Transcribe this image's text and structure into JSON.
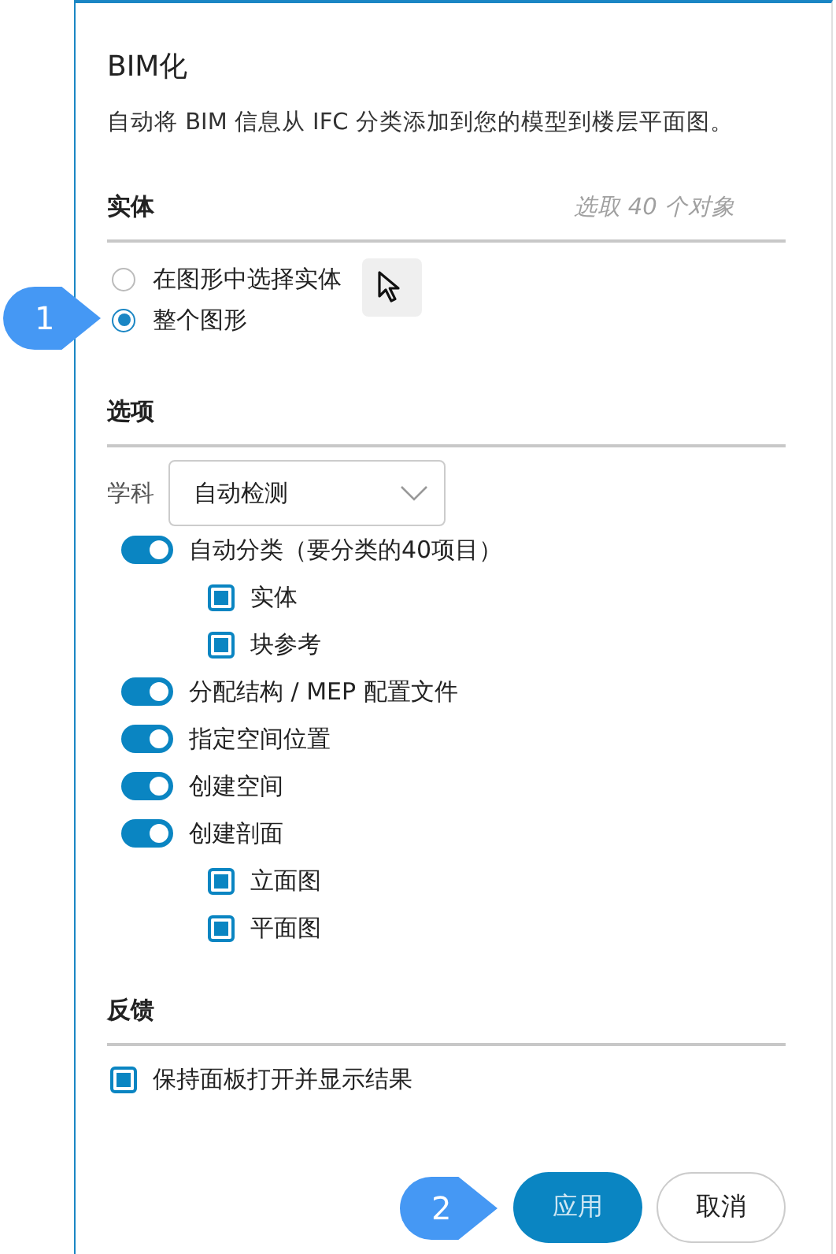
{
  "panel": {
    "title": "BIM化",
    "description": "自动将 BIM 信息从 IFC 分类添加到您的模型到楼层平面图。"
  },
  "entities": {
    "heading": "实体",
    "count": "选取 40 个对象",
    "radios": [
      {
        "label": "在图形中选择实体",
        "selected": false,
        "pick_button": true
      },
      {
        "label": "整个图形",
        "selected": true,
        "callout": "1"
      }
    ]
  },
  "options": {
    "heading": "选项",
    "discipline": {
      "label": "学科",
      "value": "自动检测"
    },
    "items": [
      {
        "kind": "toggle",
        "label": "自动分类（要分类的40项目）",
        "on": true,
        "children": [
          {
            "kind": "checkbox",
            "label": "实体",
            "checked": true
          },
          {
            "kind": "checkbox",
            "label": "块参考",
            "checked": true
          }
        ]
      },
      {
        "kind": "toggle",
        "label": "分配结构 / MEP 配置文件",
        "on": true
      },
      {
        "kind": "toggle",
        "label": "指定空间位置",
        "on": true
      },
      {
        "kind": "toggle",
        "label": "创建空间",
        "on": true
      },
      {
        "kind": "toggle",
        "label": "创建剖面",
        "on": true,
        "children": [
          {
            "kind": "checkbox",
            "label": "立面图",
            "checked": true
          },
          {
            "kind": "checkbox",
            "label": "平面图",
            "checked": true
          }
        ]
      }
    ]
  },
  "feedback": {
    "heading": "反馈",
    "items": [
      {
        "kind": "checkbox",
        "label": "保持面板打开并显示结果",
        "checked": true
      }
    ]
  },
  "buttons": [
    {
      "label": "应用",
      "kind": "primary",
      "callout": "2"
    },
    {
      "label": "取消",
      "kind": "secondary"
    }
  ]
}
